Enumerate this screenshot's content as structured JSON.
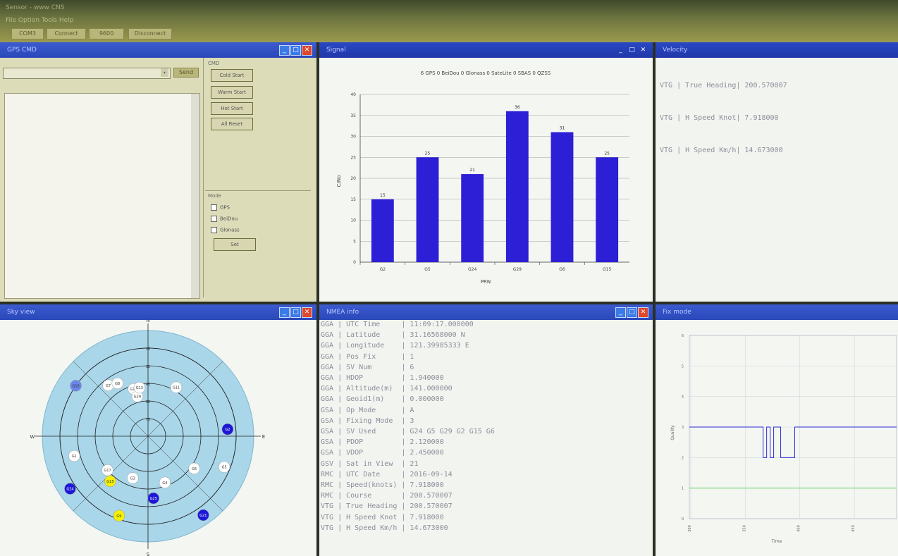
{
  "window": {
    "title": "Sensor - www CNS",
    "menu": "File  Option  Tools  Help",
    "toolbar": {
      "port": "COM3",
      "connect": "Connect",
      "baud": "9600",
      "disconnect": "Disconnect"
    }
  },
  "panes": {
    "raw": {
      "title": "GPS CMD",
      "send_label": "Send",
      "right_group": "CMD",
      "buttons": [
        "Cold Start",
        "Warm Start",
        "Hot Start",
        "All Reset"
      ],
      "mode_group": "Mode",
      "modes": [
        "GPS",
        "BeiDou",
        "Glonass"
      ],
      "set_label": "Set"
    },
    "signal": {
      "title": "Signal"
    },
    "velocity": {
      "title": "Velocity",
      "lines": [
        "VTG | True Heading| 200.570007",
        "VTG | H Speed Knot| 7.918000",
        "VTG | H Speed Km/h| 14.673000"
      ]
    },
    "sky": {
      "title": "Sky view"
    },
    "nmea": {
      "title": "NMEA info",
      "lines": [
        "GGA | UTC Time     | 11:09:17.000000",
        "GGA | Latitude     | 31.16568000 N",
        "GGA | Longitude    | 121.39985333 E",
        "GGA | Pos Fix      | 1",
        "GGA | SV Num       | 6",
        "GGA | HDOP         | 1.940000",
        "GGA | Altitude(m)  | 141.000000",
        "GGA | Geoid1(m)    | 0.000000",
        "GSA | Op Mode      | A",
        "GSA | Fixing Mode  | 3",
        "GSA | SV Used      | G24 G5 G29 G2 G15 G6",
        "GSA | PDOP         | 2.120000",
        "GSA | VDOP         | 2.450000",
        "GSV | Sat in View  | 21",
        "RMC | UTC Date     | 2016-09-14",
        "RMC | Speed(knots) | 7.918000",
        "RMC | Course       | 200.570007",
        "VTG | True Heading | 200.570007",
        "VTG | H Speed Knot | 7.918000",
        "VTG | H Speed Km/h | 14.673000"
      ]
    },
    "fix": {
      "title": "Fix mode"
    }
  },
  "sky": {
    "compass": {
      "n": "N",
      "s": "S",
      "e": "E",
      "w": "W"
    },
    "rings": [
      "15",
      "30",
      "45",
      "60",
      "75"
    ],
    "satellites": [
      {
        "id": "G16",
        "az": 305,
        "el": 15,
        "color": "#6a86e8"
      },
      {
        "id": "G7",
        "az": 322,
        "el": 35,
        "color": "#ffffff"
      },
      {
        "id": "G8",
        "az": 330,
        "el": 38,
        "color": "#ffffff"
      },
      {
        "id": "G10",
        "az": 343,
        "el": 48,
        "color": "#ffffff"
      },
      {
        "id": "G29",
        "az": 345,
        "el": 55,
        "color": "#ffffff"
      },
      {
        "id": "G13",
        "az": 350,
        "el": 48,
        "color": "#ffffff"
      },
      {
        "id": "G11",
        "az": 30,
        "el": 42,
        "color": "#ffffff"
      },
      {
        "id": "G2",
        "az": 85,
        "el": 22,
        "color": "#1d18d8"
      },
      {
        "id": "G1",
        "az": 255,
        "el": 25,
        "color": "#ffffff"
      },
      {
        "id": "G17",
        "az": 230,
        "el": 45,
        "color": "#ffffff"
      },
      {
        "id": "G15",
        "az": 220,
        "el": 40,
        "color": "#f4f000"
      },
      {
        "id": "G3",
        "az": 200,
        "el": 52,
        "color": "#ffffff"
      },
      {
        "id": "G4",
        "az": 160,
        "el": 48,
        "color": "#ffffff"
      },
      {
        "id": "G6",
        "az": 125,
        "el": 42,
        "color": "#ffffff"
      },
      {
        "id": "G5",
        "az": 112,
        "el": 20,
        "color": "#ffffff"
      },
      {
        "id": "G25",
        "az": 175,
        "el": 37,
        "color": "#1d18d8"
      },
      {
        "id": "G24",
        "az": 236,
        "el": 10,
        "color": "#1d18d8"
      },
      {
        "id": "G9",
        "az": 200,
        "el": 18,
        "color": "#f4f000"
      },
      {
        "id": "G21",
        "az": 145,
        "el": 8,
        "color": "#1d18d8"
      }
    ]
  },
  "chart_data": [
    {
      "type": "bar",
      "title": "6 GPS 0 BeiDou 0 Glonass 0 SateLite 0 SBAS 0 QZSS",
      "xlabel": "PRN",
      "ylabel": "C/No",
      "categories": [
        "G2",
        "G5",
        "G24",
        "G29",
        "G6",
        "G15"
      ],
      "values": [
        15,
        25,
        21,
        36,
        31,
        25
      ],
      "ylim": [
        0,
        40
      ],
      "yticks": [
        "0",
        "5",
        "10",
        "15",
        "20",
        "25",
        "30",
        "35",
        "40"
      ],
      "color": "#2c1fd6",
      "grid": true
    },
    {
      "type": "line",
      "title": "",
      "xlabel": "Time",
      "ylabel": "Quality",
      "ylim": [
        0,
        6
      ],
      "yticks": [
        "0",
        "1",
        "2",
        "3",
        "4",
        "5",
        "6"
      ],
      "xticks": [
        "300",
        "350",
        "400",
        "450"
      ],
      "series": [
        {
          "color": "#2b2bd6",
          "values": [
            3,
            3,
            3,
            3,
            3,
            3,
            3,
            3,
            3,
            3,
            3,
            3,
            3,
            3,
            3,
            3,
            3,
            3,
            3,
            3,
            3,
            2,
            3,
            2,
            3,
            3,
            2,
            2,
            2,
            2,
            3,
            3,
            3,
            3,
            3,
            3,
            3,
            3,
            3,
            3,
            3,
            3,
            3,
            3,
            3,
            3,
            3,
            3,
            3,
            3,
            3,
            3,
            3,
            3,
            3,
            3,
            3,
            3,
            3,
            3
          ]
        },
        {
          "color": "#5ad05a",
          "values": [
            1,
            1,
            1,
            1,
            1,
            1,
            1,
            1,
            1,
            1,
            1,
            1,
            1,
            1,
            1,
            1,
            1,
            1,
            1,
            1,
            1,
            1,
            1,
            1,
            1,
            1,
            1,
            1,
            1,
            1,
            1,
            1,
            1,
            1,
            1,
            1,
            1,
            1,
            1,
            1,
            1,
            1,
            1,
            1,
            1,
            1,
            1,
            1,
            1,
            1,
            1,
            1,
            1,
            1,
            1,
            1,
            1,
            1,
            1,
            1
          ]
        }
      ],
      "grid": true
    }
  ]
}
